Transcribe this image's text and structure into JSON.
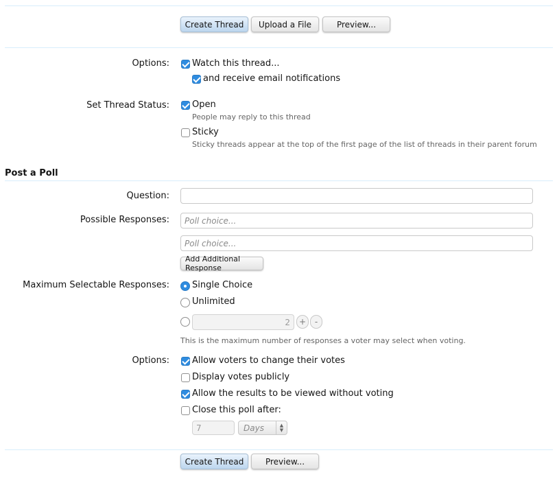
{
  "top_buttons": {
    "create_thread": "Create Thread",
    "upload_file": "Upload a File",
    "preview": "Preview..."
  },
  "options": {
    "label": "Options:",
    "watch_thread": {
      "label": "Watch this thread...",
      "checked": true
    },
    "email_notifications": {
      "label": "and receive email notifications",
      "checked": true
    }
  },
  "thread_status": {
    "label": "Set Thread Status:",
    "open": {
      "label": "Open",
      "checked": true,
      "hint": "People may reply to this thread"
    },
    "sticky": {
      "label": "Sticky",
      "checked": false,
      "hint": "Sticky threads appear at the top of the first page of the list of threads in their parent forum"
    }
  },
  "poll": {
    "section_title": "Post a Poll",
    "question_label": "Question:",
    "question_value": "",
    "responses_label": "Possible Responses:",
    "response_placeholders": [
      "Poll choice...",
      "Poll choice..."
    ],
    "add_response_button": "Add Additional Response",
    "max_responses_label": "Maximum Selectable Responses:",
    "single_choice": {
      "label": "Single Choice",
      "selected": true
    },
    "unlimited": {
      "label": "Unlimited",
      "selected": false
    },
    "custom_count": {
      "value": "2",
      "selected": false
    },
    "max_hint": "This is the maximum number of responses a voter may select when voting.",
    "options_label": "Options:",
    "allow_change_votes": {
      "label": "Allow voters to change their votes",
      "checked": true
    },
    "display_votes_public": {
      "label": "Display votes publicly",
      "checked": false
    },
    "view_results_without_voting": {
      "label": "Allow the results to be viewed without voting",
      "checked": true
    },
    "close_poll_after": {
      "label": "Close this poll after:",
      "checked": false
    },
    "close_after_value": "7",
    "close_after_unit": "Days"
  },
  "bottom_buttons": {
    "create_thread": "Create Thread",
    "preview": "Preview..."
  },
  "colors": {
    "accent": "#2f8ce0",
    "divider": "#d7edfc",
    "primary_button": "#bcd6ee"
  }
}
